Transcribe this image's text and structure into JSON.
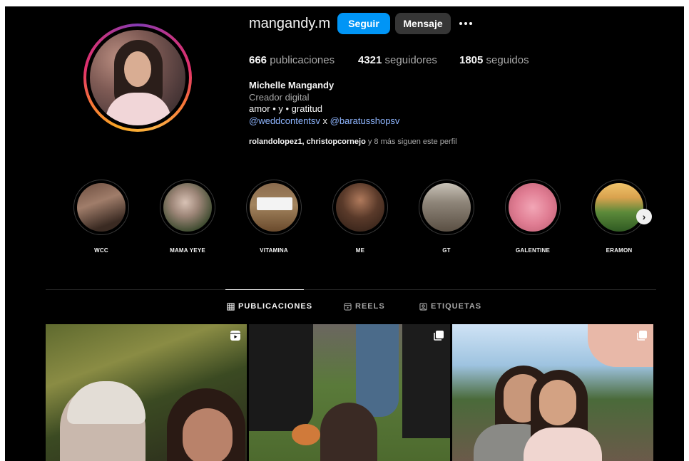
{
  "profile": {
    "username": "mangandy.m",
    "follow_label": "Seguir",
    "message_label": "Mensaje",
    "stats": {
      "posts_count": "666",
      "posts_label": "publicaciones",
      "followers_count": "4321",
      "followers_label": "seguidores",
      "following_count": "1805",
      "following_label": "seguidos"
    },
    "bio": {
      "full_name": "Michelle Mangandy",
      "category": "Creador digital",
      "text": "amor • y • gratitud",
      "link1": "@weddcontentsv",
      "separator": "x",
      "link2": "@baratusshopsv"
    },
    "followed_by": {
      "names": "rolandolopez1, christopcornejo",
      "suffix": "y 8 más siguen este perfil"
    }
  },
  "highlights": [
    {
      "label": "WCC"
    },
    {
      "label": "MAMA YEYE"
    },
    {
      "label": "VITAMINA"
    },
    {
      "label": "ME"
    },
    {
      "label": "GT"
    },
    {
      "label": "GALENTINE"
    },
    {
      "label": "ERAMON"
    }
  ],
  "tabs": [
    {
      "label": "PUBLICACIONES",
      "icon": "grid-icon",
      "active": true
    },
    {
      "label": "REELS",
      "icon": "reels-icon",
      "active": false
    },
    {
      "label": "ETIQUETAS",
      "icon": "tagged-icon",
      "active": false
    }
  ],
  "posts": [
    {
      "type": "reel",
      "badge_icon": "reels-icon"
    },
    {
      "type": "carousel",
      "badge_icon": "carousel-icon"
    },
    {
      "type": "carousel",
      "badge_icon": "carousel-icon"
    }
  ],
  "colors": {
    "background": "#000000",
    "primary_button": "#0095f6",
    "secondary_button": "#363636",
    "link": "#8fb6ff",
    "muted_text": "#a8a8a8"
  }
}
